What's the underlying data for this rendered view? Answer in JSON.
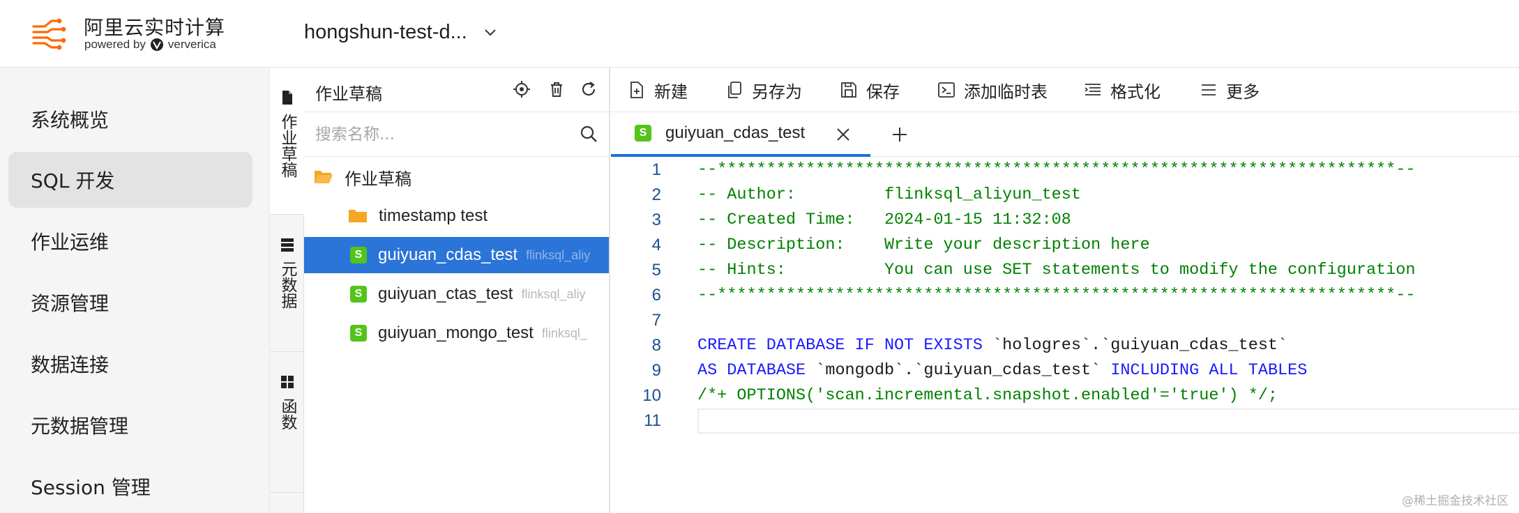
{
  "header": {
    "brand_title": "阿里云实时计算",
    "powered_by": "powered by",
    "vendor": "ververica",
    "workspace_name": "hongshun-test-d..."
  },
  "leftnav": {
    "items": [
      {
        "label": "系统概览",
        "active": false
      },
      {
        "label": "SQL 开发",
        "active": true
      },
      {
        "label": "作业运维",
        "active": false
      },
      {
        "label": "资源管理",
        "active": false
      },
      {
        "label": "数据连接",
        "active": false
      },
      {
        "label": "元数据管理",
        "active": false
      },
      {
        "label": "Session 管理",
        "active": false
      }
    ]
  },
  "vtabs": [
    {
      "label": "作业草稿",
      "icon": "file-icon",
      "active": true
    },
    {
      "label": "元数据",
      "icon": "database-icon",
      "active": false
    },
    {
      "label": "函数",
      "icon": "grid-icon",
      "active": false
    }
  ],
  "drafts": {
    "title": "作业草稿",
    "search_placeholder": "搜索名称...",
    "tree": [
      {
        "name": "作业草稿",
        "type": "folder-open",
        "meta": ""
      },
      {
        "name": "timestamp test",
        "type": "folder",
        "meta": ""
      },
      {
        "name": "guiyuan_cdas_test",
        "type": "sql",
        "meta": "flinksql_aliy",
        "selected": true
      },
      {
        "name": "guiyuan_ctas_test",
        "type": "sql",
        "meta": "flinksql_aliy"
      },
      {
        "name": "guiyuan_mongo_test",
        "type": "sql",
        "meta": "flinksql_"
      }
    ]
  },
  "toolbar": {
    "new_label": "新建",
    "save_as_label": "另存为",
    "save_label": "保存",
    "add_temp_table_label": "添加临时表",
    "format_label": "格式化",
    "more_label": "更多"
  },
  "tabs": {
    "open_file": "guiyuan_cdas_test",
    "badge": "S"
  },
  "editor": {
    "lines": [
      {
        "n": "1",
        "segments": [
          {
            "t": "--*********************************************************************--",
            "c": "com"
          }
        ]
      },
      {
        "n": "2",
        "segments": [
          {
            "t": "-- Author:         flinksql_aliyun_test",
            "c": "com"
          }
        ]
      },
      {
        "n": "3",
        "segments": [
          {
            "t": "-- Created Time:   2024-01-15 11:32:08",
            "c": "com"
          }
        ]
      },
      {
        "n": "4",
        "segments": [
          {
            "t": "-- Description:    Write your description here",
            "c": "com"
          }
        ]
      },
      {
        "n": "5",
        "segments": [
          {
            "t": "-- Hints:          You can use SET statements to modify the configuration",
            "c": "com"
          }
        ]
      },
      {
        "n": "6",
        "segments": [
          {
            "t": "--*********************************************************************--",
            "c": "com"
          }
        ]
      },
      {
        "n": "7",
        "segments": []
      },
      {
        "n": "8",
        "segments": [
          {
            "t": "CREATE DATABASE IF NOT EXISTS",
            "c": "kw"
          },
          {
            "t": " `hologres`.`guiyuan_cdas_test`",
            "c": "txt"
          }
        ]
      },
      {
        "n": "9",
        "segments": [
          {
            "t": "AS DATABASE",
            "c": "kw"
          },
          {
            "t": " `mongodb`.`guiyuan_cdas_test` ",
            "c": "txt"
          },
          {
            "t": "INCLUDING ALL TABLES",
            "c": "kw"
          }
        ]
      },
      {
        "n": "10",
        "segments": [
          {
            "t": "/*+ OPTIONS('scan.incremental.snapshot.enabled'='true') */;",
            "c": "com"
          }
        ]
      },
      {
        "n": "11",
        "segments": [],
        "current": true
      }
    ]
  },
  "watermark": "@稀土掘金技术社区",
  "colors": {
    "accent": "#2b74d8",
    "sql_badge": "#52c41a",
    "comment": "#008000",
    "keyword": "#1a1aff"
  }
}
